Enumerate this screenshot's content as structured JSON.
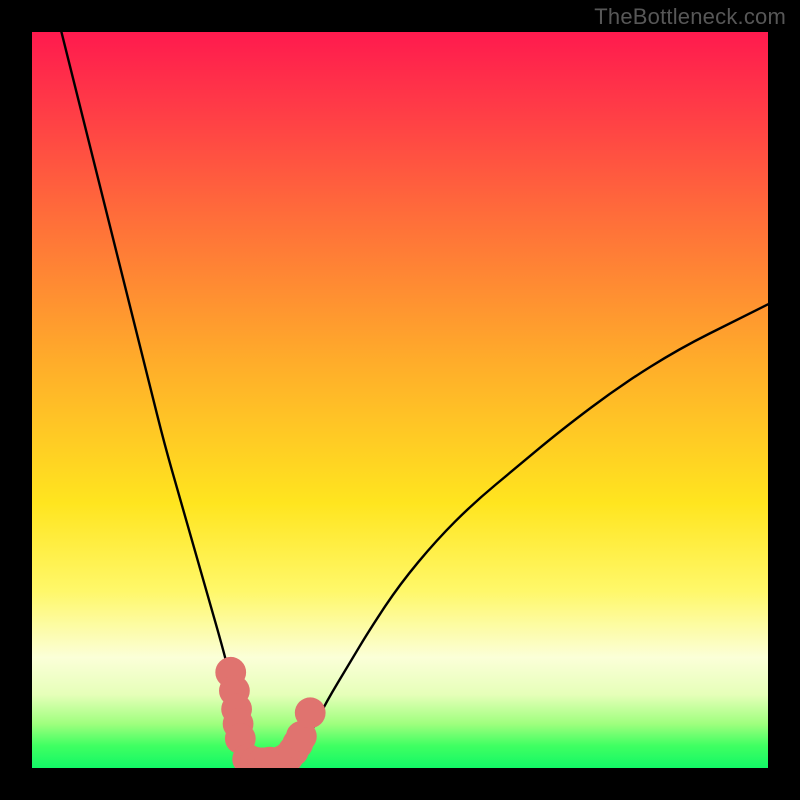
{
  "watermark": "TheBottleneck.com",
  "chart_data": {
    "type": "line",
    "title": "",
    "xlabel": "",
    "ylabel": "",
    "xlim": [
      0,
      100
    ],
    "ylim": [
      0,
      100
    ],
    "series": [
      {
        "name": "bottleneck-curve",
        "x": [
          4,
          6,
          8,
          10,
          12,
          14,
          16,
          18,
          20,
          22,
          24,
          26,
          27,
          28,
          29,
          30,
          31,
          32,
          33,
          34,
          35,
          36,
          38,
          40,
          43,
          46,
          50,
          55,
          60,
          66,
          72,
          80,
          88,
          96,
          100
        ],
        "y": [
          100,
          92,
          84,
          76,
          68,
          60,
          52,
          44,
          37,
          30,
          23,
          16,
          12,
          8,
          5,
          2.5,
          1,
          0.5,
          0.5,
          0.5,
          1,
          2,
          5,
          9,
          14,
          19,
          25,
          31,
          36,
          41,
          46,
          52,
          57,
          61,
          63
        ]
      }
    ],
    "markers": {
      "name": "highlight-cluster",
      "color": "#e0736f",
      "points": [
        {
          "x": 27.0,
          "y": 13.0,
          "r": 1.5
        },
        {
          "x": 27.5,
          "y": 10.5,
          "r": 1.5
        },
        {
          "x": 27.8,
          "y": 8.0,
          "r": 1.5
        },
        {
          "x": 28.0,
          "y": 6.0,
          "r": 1.5
        },
        {
          "x": 28.3,
          "y": 4.0,
          "r": 1.5
        },
        {
          "x": 29.3,
          "y": 1.2,
          "r": 1.5
        },
        {
          "x": 30.3,
          "y": 0.8,
          "r": 1.5
        },
        {
          "x": 31.3,
          "y": 0.7,
          "r": 1.5
        },
        {
          "x": 32.3,
          "y": 0.8,
          "r": 1.5
        },
        {
          "x": 33.2,
          "y": 0.7,
          "r": 1.5
        },
        {
          "x": 34.0,
          "y": 1.0,
          "r": 1.5
        },
        {
          "x": 34.8,
          "y": 1.5,
          "r": 1.5
        },
        {
          "x": 35.5,
          "y": 2.3,
          "r": 1.5
        },
        {
          "x": 36.1,
          "y": 3.3,
          "r": 1.5
        },
        {
          "x": 36.6,
          "y": 4.3,
          "r": 1.5
        },
        {
          "x": 37.8,
          "y": 7.5,
          "r": 1.5
        }
      ]
    },
    "background_gradient": {
      "direction": "vertical",
      "stops": [
        {
          "pos": 0,
          "color": "#ff1a4e"
        },
        {
          "pos": 25,
          "color": "#ff6d3a"
        },
        {
          "pos": 50,
          "color": "#ffd520"
        },
        {
          "pos": 80,
          "color": "#fdff9c"
        },
        {
          "pos": 100,
          "color": "#12f866"
        }
      ]
    }
  }
}
